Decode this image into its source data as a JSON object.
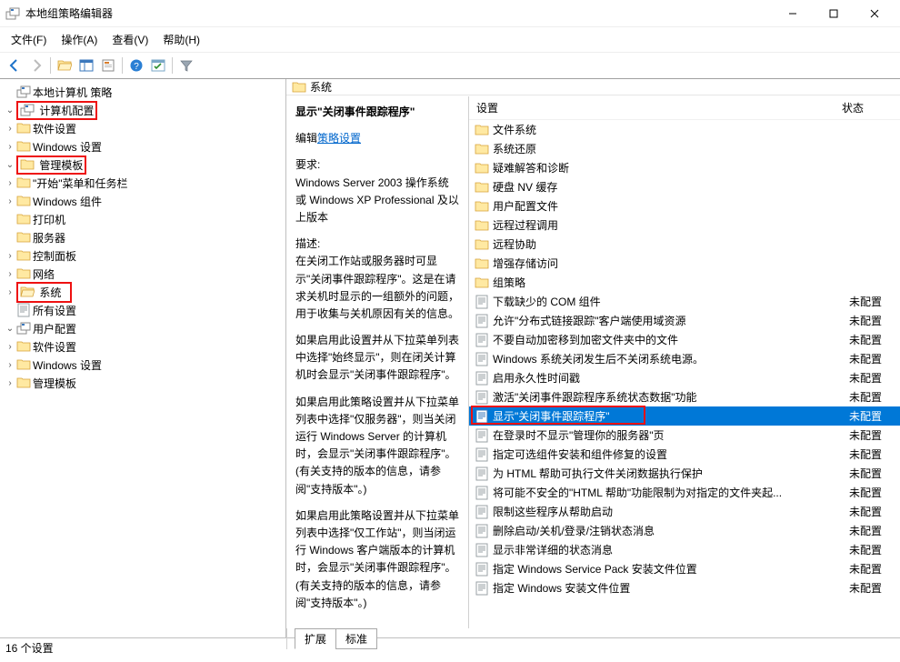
{
  "window": {
    "title": "本地组策略编辑器"
  },
  "menu": {
    "file": "文件(F)",
    "action": "操作(A)",
    "view": "查看(V)",
    "help": "帮助(H)"
  },
  "tree": {
    "root": "本地计算机 策略",
    "comp_config": "计算机配置",
    "software_settings": "软件设置",
    "windows_settings": "Windows 设置",
    "admin_templates": "管理模板",
    "start_taskbar": "\"开始\"菜单和任务栏",
    "win_components": "Windows 组件",
    "printers": "打印机",
    "servers": "服务器",
    "ctrl_panel": "控制面板",
    "network": "网络",
    "system": "系统",
    "all_settings": "所有设置",
    "user_config": "用户配置",
    "u_software": "软件设置",
    "u_windows": "Windows 设置",
    "u_admin": "管理模板"
  },
  "right": {
    "title": "系统",
    "detail_heading": "显示\"关闭事件跟踪程序\"",
    "edit_link": "策略设置",
    "edit_prefix": "编辑",
    "req_label": "要求:",
    "req_body": "Windows Server 2003 操作系统或 Windows XP Professional 及以上版本",
    "desc_label": "描述:",
    "p1": "在关闭工作站或服务器时可显示\"关闭事件跟踪程序\"。这是在请求关机时显示的一组额外的问题，用于收集与关机原因有关的信息。",
    "p2": "如果启用此设置并从下拉菜单列表中选择\"始终显示\"，则在闭关计算机时会显示\"关闭事件跟踪程序\"。",
    "p3": "如果启用此策略设置并从下拉菜单列表中选择\"仅服务器\"，则当关闭运行 Windows Server 的计算机时，会显示\"关闭事件跟踪程序\"。(有关支持的版本的信息，请参阅\"支持版本\"。)",
    "p4": "如果启用此策略设置并从下拉菜单列表中选择\"仅工作站\"，则当闭运行 Windows 客户端版本的计算机时，会显示\"关闭事件跟踪程序\"。(有关支持的版本的信息，请参阅\"支持版本\"。)",
    "col_setting": "设置",
    "col_status": "状态",
    "items": [
      {
        "type": "folder",
        "name": "文件系统",
        "status": ""
      },
      {
        "type": "folder",
        "name": "系统还原",
        "status": ""
      },
      {
        "type": "folder",
        "name": "疑难解答和诊断",
        "status": ""
      },
      {
        "type": "folder",
        "name": "硬盘 NV 缓存",
        "status": ""
      },
      {
        "type": "folder",
        "name": "用户配置文件",
        "status": ""
      },
      {
        "type": "folder",
        "name": "远程过程调用",
        "status": ""
      },
      {
        "type": "folder",
        "name": "远程协助",
        "status": ""
      },
      {
        "type": "folder",
        "name": "增强存储访问",
        "status": ""
      },
      {
        "type": "folder",
        "name": "组策略",
        "status": ""
      },
      {
        "type": "setting",
        "name": "下载缺少的 COM 组件",
        "status": "未配置"
      },
      {
        "type": "setting",
        "name": "允许\"分布式链接跟踪\"客户端使用域资源",
        "status": "未配置"
      },
      {
        "type": "setting",
        "name": "不要自动加密移到加密文件夹中的文件",
        "status": "未配置"
      },
      {
        "type": "setting",
        "name": "Windows 系统关闭发生后不关闭系统电源。",
        "status": "未配置"
      },
      {
        "type": "setting",
        "name": "启用永久性时间戳",
        "status": "未配置"
      },
      {
        "type": "setting",
        "name": "激活\"关闭事件跟踪程序系统状态数据\"功能",
        "status": "未配置"
      },
      {
        "type": "setting",
        "name": "显示\"关闭事件跟踪程序\"",
        "status": "未配置",
        "selected": true,
        "highlight": true
      },
      {
        "type": "setting",
        "name": "在登录时不显示\"管理你的服务器\"页",
        "status": "未配置"
      },
      {
        "type": "setting",
        "name": "指定可选组件安装和组件修复的设置",
        "status": "未配置"
      },
      {
        "type": "setting",
        "name": "为 HTML 帮助可执行文件关闭数据执行保护",
        "status": "未配置"
      },
      {
        "type": "setting",
        "name": "将可能不安全的\"HTML 帮助\"功能限制为对指定的文件夹起...",
        "status": "未配置"
      },
      {
        "type": "setting",
        "name": "限制这些程序从帮助启动",
        "status": "未配置"
      },
      {
        "type": "setting",
        "name": "删除启动/关机/登录/注销状态消息",
        "status": "未配置"
      },
      {
        "type": "setting",
        "name": "显示非常详细的状态消息",
        "status": "未配置"
      },
      {
        "type": "setting",
        "name": "指定 Windows Service Pack 安装文件位置",
        "status": "未配置"
      },
      {
        "type": "setting",
        "name": "指定 Windows 安装文件位置",
        "status": "未配置"
      }
    ]
  },
  "tabs": {
    "extended": "扩展",
    "standard": "标准"
  },
  "status": "16 个设置"
}
